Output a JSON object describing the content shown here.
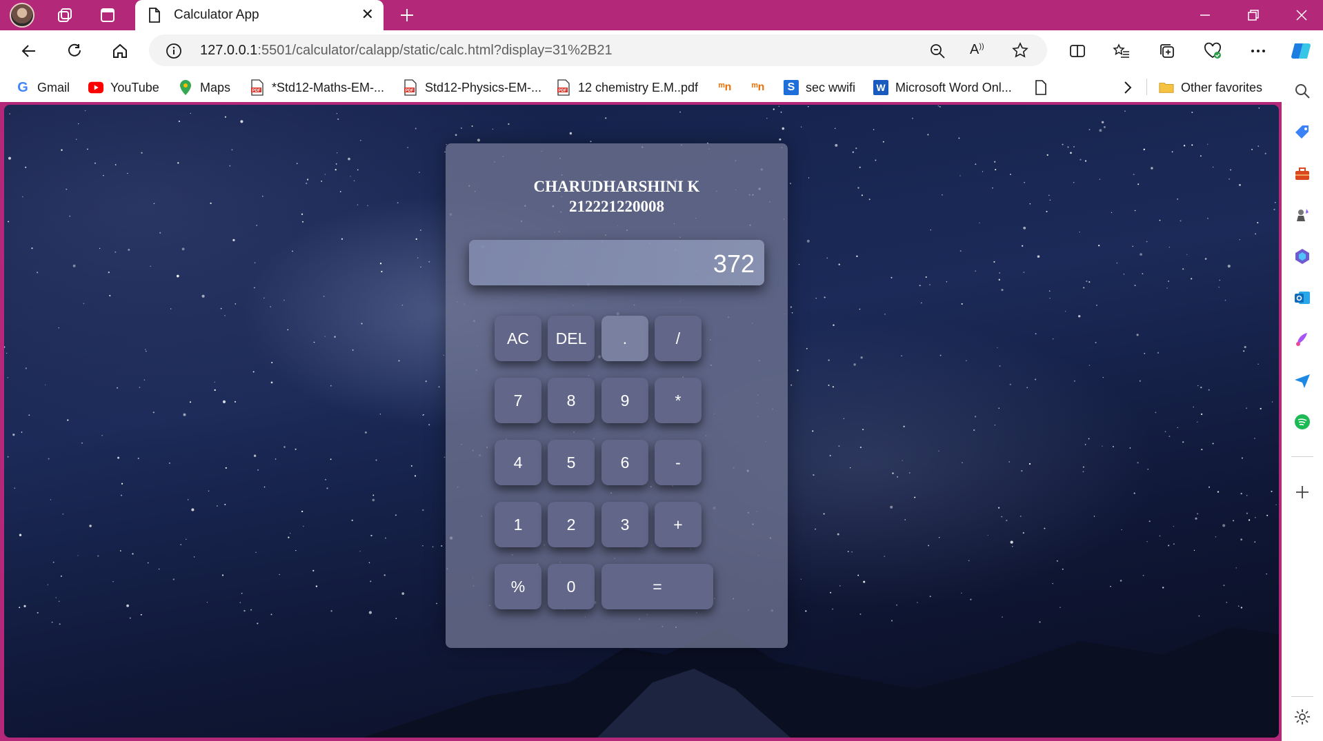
{
  "browser": {
    "tab": {
      "title": "Calculator App"
    },
    "address": {
      "host": "127.0.0.1",
      "path": ":5501/calculator/calapp/static/calc.html?display=31%2B21"
    },
    "bookmarks": [
      {
        "label": "Gmail",
        "icon": "gmail-icon"
      },
      {
        "label": "YouTube",
        "icon": "youtube-icon"
      },
      {
        "label": "Maps",
        "icon": "maps-icon"
      },
      {
        "label": "*Std12-Maths-EM-...",
        "icon": "pdf-icon"
      },
      {
        "label": "Std12-Physics-EM-...",
        "icon": "pdf-icon"
      },
      {
        "label": "12 chemistry E.M..pdf",
        "icon": "pdf-icon"
      },
      {
        "label": "",
        "icon": "site-icon"
      },
      {
        "label": "",
        "icon": "site-icon"
      },
      {
        "label": "sec wwifi",
        "icon": "s-icon"
      },
      {
        "label": "Microsoft Word Onl...",
        "icon": "word-icon"
      }
    ],
    "other_favorites": "Other favorites"
  },
  "calculator": {
    "name": "CHARUDHARSHINI K",
    "id": "212221220008",
    "display": "372",
    "keys": {
      "ac": "AC",
      "del": "DEL",
      "dot": ".",
      "div": "/",
      "k7": "7",
      "k8": "8",
      "k9": "9",
      "mul": "*",
      "k4": "4",
      "k5": "5",
      "k6": "6",
      "sub": "-",
      "k1": "1",
      "k2": "2",
      "k3": "3",
      "add": "+",
      "pct": "%",
      "k0": "0",
      "eq": "="
    }
  },
  "colors": {
    "titlebar": "#b4287a",
    "calc_panel": "#6e7391",
    "key": "#62678a"
  }
}
